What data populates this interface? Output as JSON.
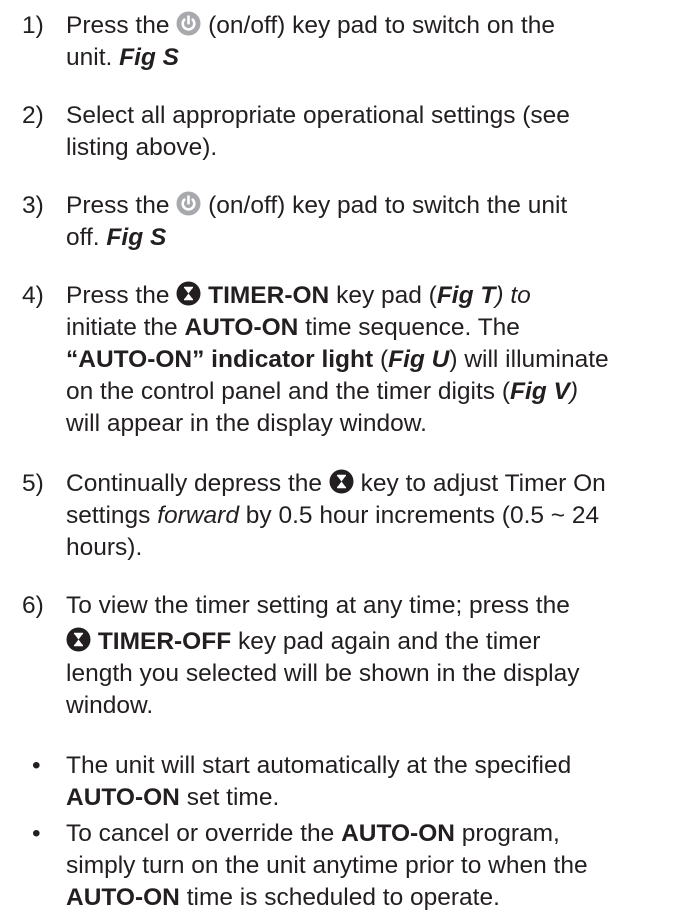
{
  "steps": [
    {
      "num": "1)",
      "a": "Press the",
      "b": "(on/off) key pad to switch on the",
      "c": "unit.",
      "fig": "Fig S"
    },
    {
      "num": "2)",
      "l1": "Select all appropriate operational settings (see",
      "l2": "listing above)."
    },
    {
      "num": "3)",
      "a": "Press the",
      "b": "(on/off) key pad to switch the unit",
      "c": "off.",
      "fig": "Fig S"
    },
    {
      "num": "4)",
      "a": "Press the",
      "key": "TIMER-ON",
      "b": "key pad (",
      "fig1": "Fig T",
      "c": ")  to",
      "d": "initiate the",
      "auto": "AUTO-ON",
      "e": "time sequence. The",
      "f": "“AUTO-ON” indicator light",
      "g": "(",
      "fig2": "Fig U",
      "h": ") will illuminate",
      "i": "on the control panel and the timer digits (",
      "fig3": "Fig V",
      "j": ")",
      "k": "will appear in the display window."
    },
    {
      "num": "5)",
      "a": "Continually depress the",
      "b": "key to adjust Timer On",
      "c": "settings",
      "fwd": "forward",
      "d": "by 0.5 hour increments (0.5 ~ 24",
      "e": "hours)."
    },
    {
      "num": "6)",
      "a": "To view the timer setting at any time;  press the",
      "key": "TIMER-OFF",
      "b": "key pad again and the timer",
      "c": "length you selected will be shown in the display",
      "d": "window."
    }
  ],
  "bullets": [
    {
      "sym": "•",
      "a": "The unit will start automatically at the specified",
      "auto": "AUTO-ON",
      "b": "set time."
    },
    {
      "sym": "•",
      "a": "To cancel or override the",
      "auto1": "AUTO-ON",
      "b": "program,",
      "c": "simply turn on the unit anytime prior to when the",
      "auto2": "AUTO-ON",
      "d": "time is scheduled to operate."
    }
  ],
  "icons": {
    "power": "power-icon",
    "timer": "hourglass-timer-icon",
    "power_color": "#a7a9ac",
    "timer_color": "#231f20"
  }
}
